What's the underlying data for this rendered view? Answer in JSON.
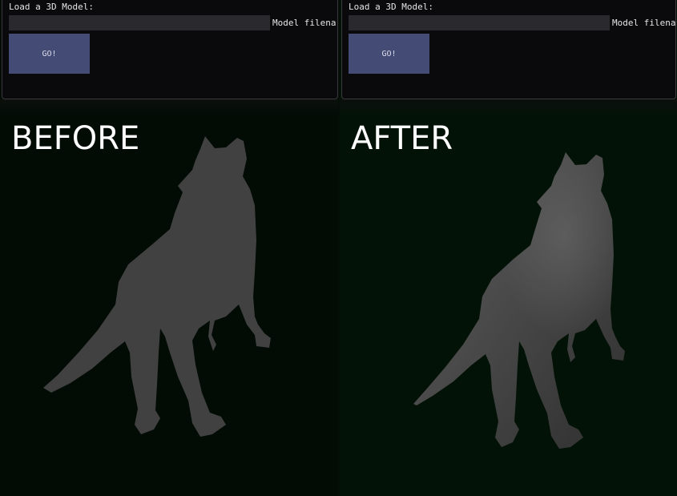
{
  "panels": [
    {
      "label": "Load a 3D Model:",
      "input_value": "",
      "input_label": "Model filena",
      "button_label": "GO!"
    },
    {
      "label": "Load a 3D Model:",
      "input_value": "",
      "input_label": "Model filena",
      "button_label": "GO!"
    }
  ],
  "captions": {
    "left": "BEFORE",
    "right": "AFTER"
  },
  "colors": {
    "background": "#020c05",
    "panel": "#0a0a0c",
    "button": "#444c75",
    "model_flat": "#414141",
    "model_shaded_light": "#5a5a5a",
    "model_shaded_dark": "#2e2e2e"
  }
}
